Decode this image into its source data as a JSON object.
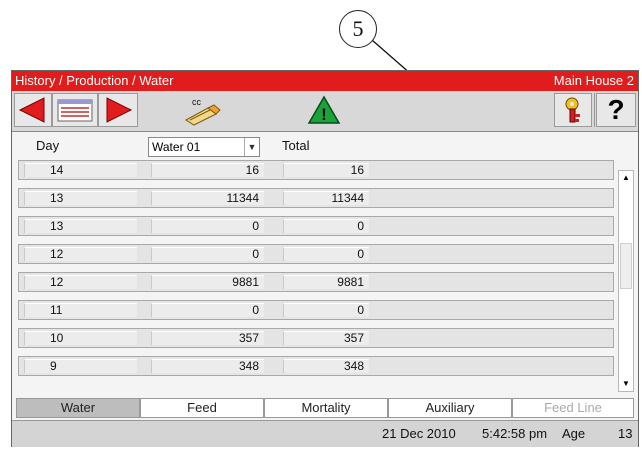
{
  "callout": {
    "number": "5"
  },
  "window": {
    "title": "History / Production / Water",
    "house": "Main House 2"
  },
  "toolbar": {
    "buttons": [
      {
        "icon": "arrow-left-icon"
      },
      {
        "icon": "list-card-icon"
      },
      {
        "icon": "arrow-right-icon"
      },
      {
        "icon": "cc-pencil-icon",
        "label": "cc"
      },
      {
        "icon": "warning-icon",
        "label": "!"
      },
      {
        "icon": "key-icon"
      },
      {
        "icon": "help-icon",
        "label": "?"
      }
    ],
    "colors": {
      "nav_red": "#e01c1c",
      "warning_green": "#1aa33a"
    }
  },
  "table": {
    "headers": {
      "day": "Day",
      "total": "Total"
    },
    "selector": {
      "selected": "Water 01"
    },
    "rows": [
      {
        "day": "14",
        "water": "16",
        "total": "16"
      },
      {
        "day": "13",
        "water": "11344",
        "total": "11344"
      },
      {
        "day": "13",
        "water": "0",
        "total": "0"
      },
      {
        "day": "12",
        "water": "0",
        "total": "0"
      },
      {
        "day": "12",
        "water": "9881",
        "total": "9881"
      },
      {
        "day": "11",
        "water": "0",
        "total": "0"
      },
      {
        "day": "10",
        "water": "357",
        "total": "357"
      },
      {
        "day": "9",
        "water": "348",
        "total": "348"
      }
    ]
  },
  "tabs": [
    {
      "label": "Water",
      "state": "active"
    },
    {
      "label": "Feed",
      "state": "normal"
    },
    {
      "label": "Mortality",
      "state": "normal"
    },
    {
      "label": "Auxiliary",
      "state": "normal"
    },
    {
      "label": "Feed Line",
      "state": "disabled"
    }
  ],
  "status": {
    "date": "21 Dec 2010",
    "time": "5:42:58 pm",
    "age_label": "Age",
    "age_value": "13"
  }
}
